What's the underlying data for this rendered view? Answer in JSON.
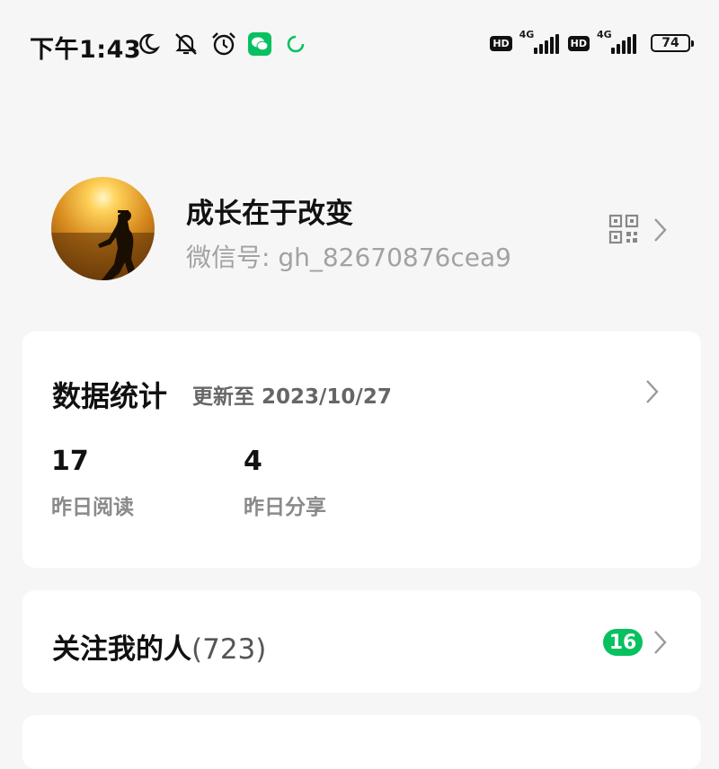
{
  "status_bar": {
    "time": "下午1:43",
    "icons": [
      "moon-icon",
      "mute-icon",
      "alarm-icon",
      "wechat-icon",
      "sync-icon"
    ],
    "network": [
      {
        "hd": "HD",
        "type": "4G"
      },
      {
        "hd": "HD",
        "type": "4G"
      }
    ],
    "battery": "74"
  },
  "profile": {
    "name": "成长在于改变",
    "wechat_id": "微信号: gh_82670876cea9"
  },
  "stats": {
    "title": "数据统计",
    "updated": "更新至 2023/10/27",
    "items": [
      {
        "value": "17",
        "label": "昨日阅读"
      },
      {
        "value": "4",
        "label": "昨日分享"
      }
    ]
  },
  "followers": {
    "label": "关注我的人",
    "count": "(723)",
    "new_badge": "16"
  },
  "colors": {
    "accent": "#07c160",
    "background": "#f6f6f6",
    "card": "#ffffff"
  }
}
